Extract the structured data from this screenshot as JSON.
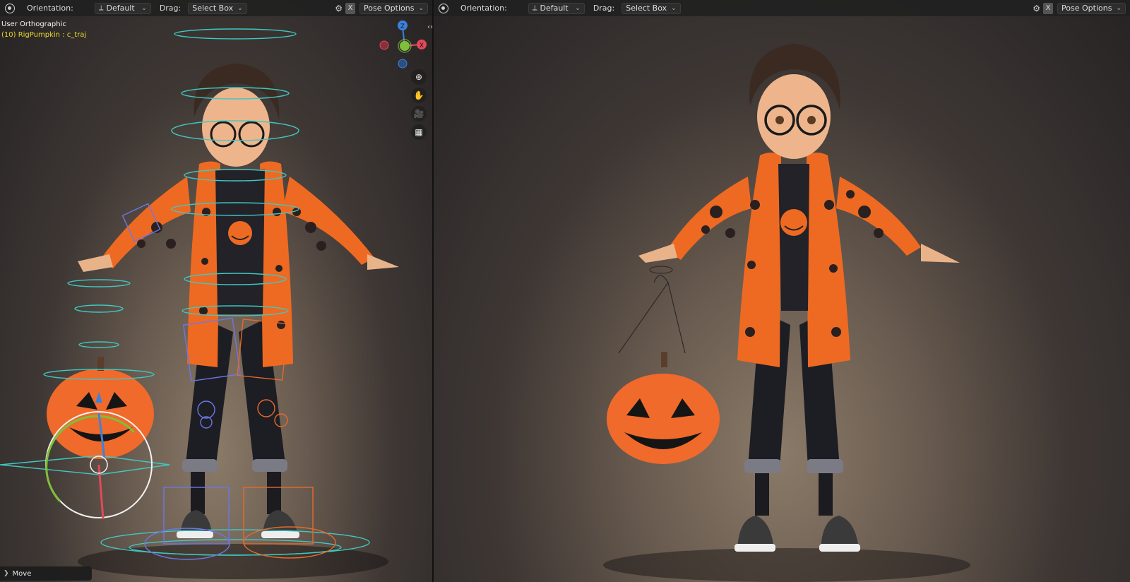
{
  "left_header": {
    "orientation_label": "Orientation:",
    "orientation_value": "Default",
    "drag_label": "Drag:",
    "drag_value": "Select Box",
    "x_label": "X",
    "pose_options": "Pose Options"
  },
  "right_header": {
    "orientation_label": "Orientation:",
    "orientation_value": "Default",
    "drag_label": "Drag:",
    "drag_value": "Select Box",
    "x_label": "X",
    "pose_options": "Pose Options"
  },
  "overlay": {
    "view_name": "User Orthographic",
    "object_info": "(10) RigPumpkin : c_traj"
  },
  "gizmo": {
    "z_label": "Z",
    "x_label": "X",
    "colors": {
      "x": "#e04a5a",
      "y": "#7fbf3a",
      "z": "#3d82d9"
    }
  },
  "nav_tools": [
    {
      "name": "zoom-icon",
      "glyph": "⊕"
    },
    {
      "name": "hand-pan-icon",
      "glyph": "✋"
    },
    {
      "name": "camera-icon",
      "glyph": "🎥"
    },
    {
      "name": "grid-icon",
      "glyph": "▦"
    }
  ],
  "operator_panel": {
    "label": "Move"
  },
  "colors": {
    "header_bg": "#202020",
    "jacket": "#ee6a22",
    "pumpkin": "#f06a2b",
    "rig_cyan": "#3fc7c2",
    "rig_blue": "#6d77e6",
    "rig_orange": "#e66a2a"
  }
}
